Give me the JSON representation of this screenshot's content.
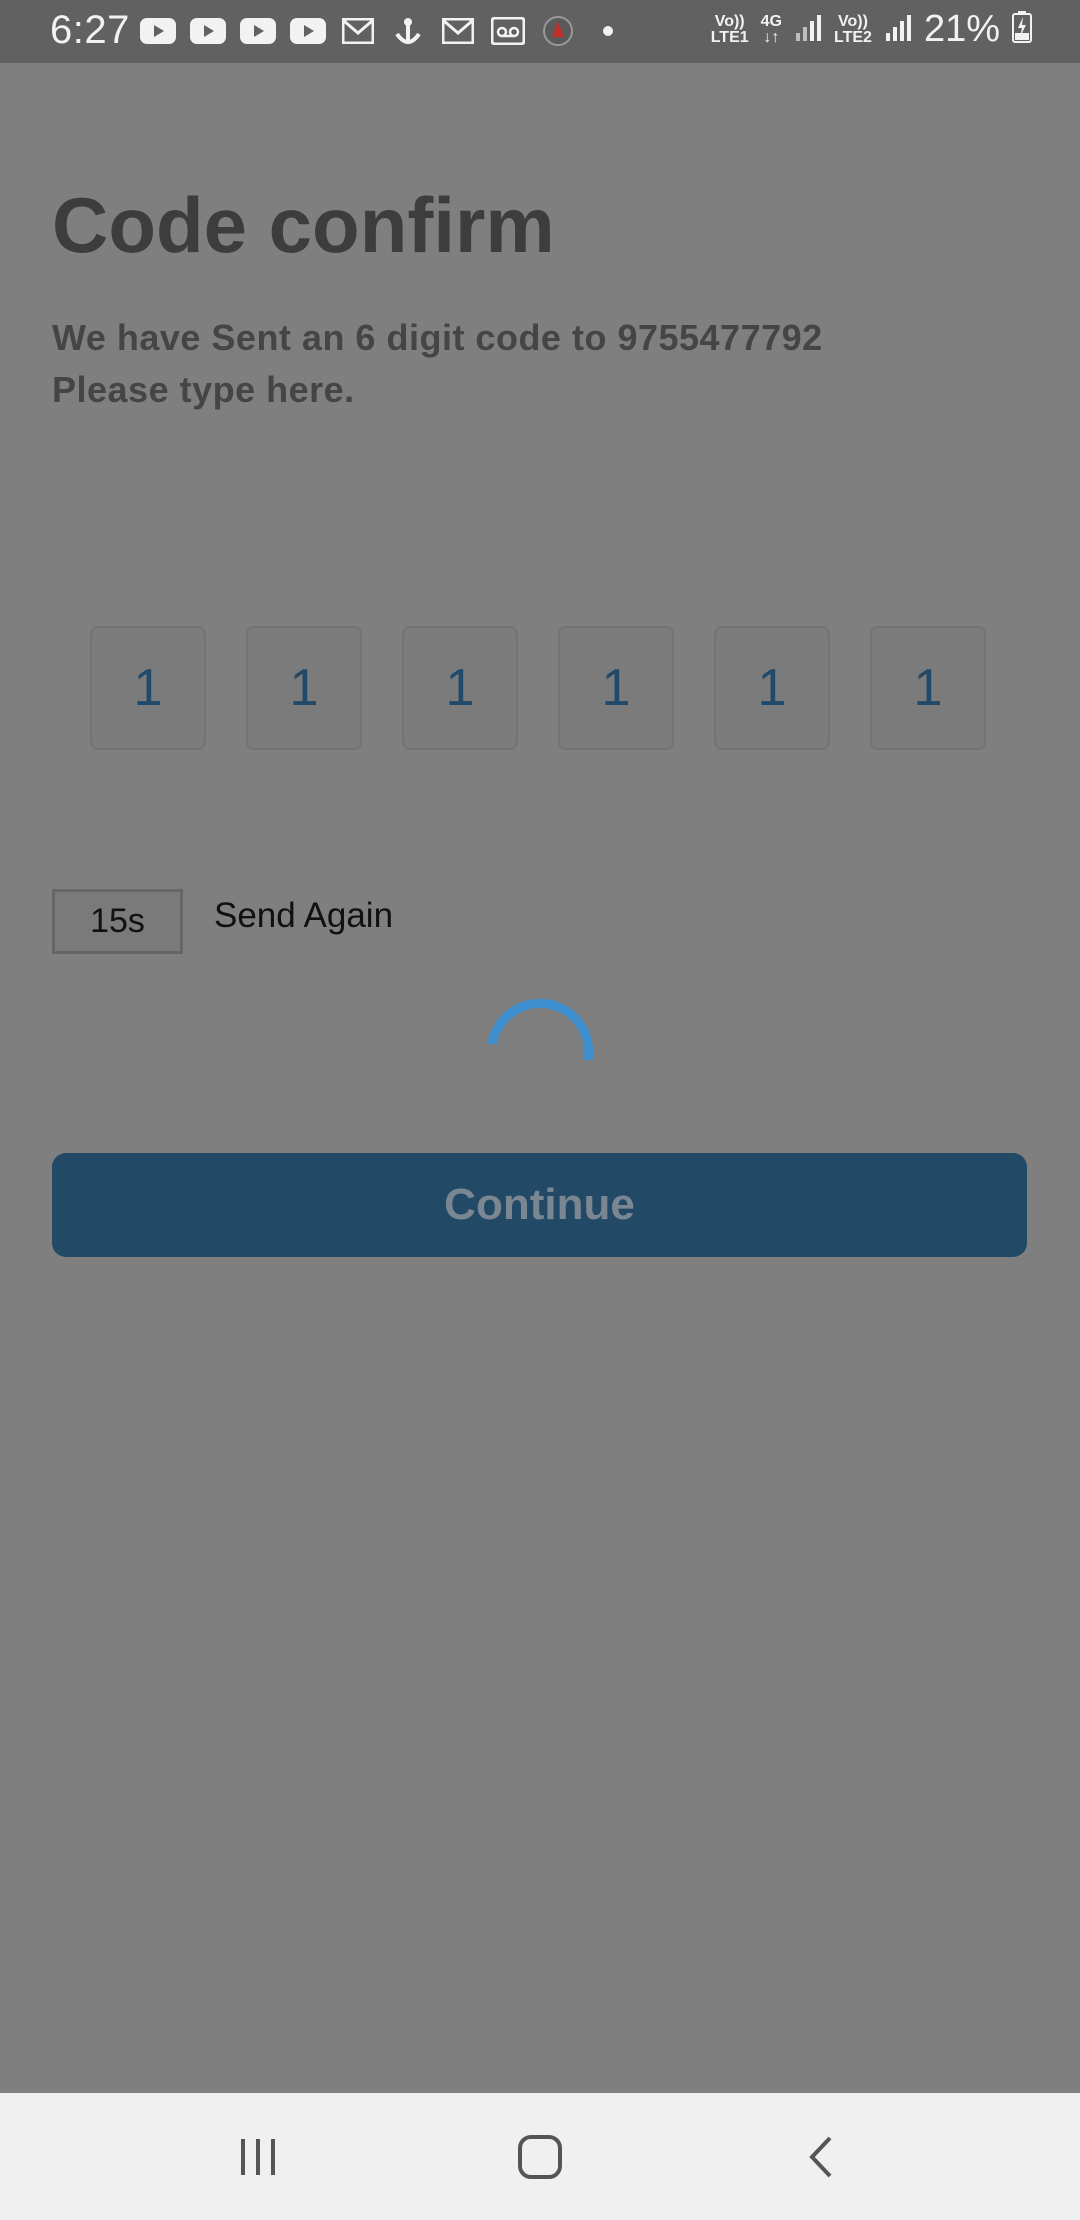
{
  "status_bar": {
    "time": "6:27",
    "notification_icons": [
      "youtube-icon",
      "youtube-icon",
      "youtube-icon",
      "youtube-icon",
      "gmail-icon",
      "anchor-icon",
      "gmail-icon",
      "voicemail-icon",
      "app-icon",
      "dot-icon"
    ],
    "lte1_line1": "Vo))",
    "lte1_line2": "LTE1",
    "net_line1": "4G",
    "net_line2": "↓↑",
    "lte2_line1": "Vo))",
    "lte2_line2": "LTE2",
    "battery": "21%"
  },
  "page": {
    "title": "Code confirm",
    "subtitle_line1": "We have Sent an 6 digit code to 9755477792",
    "subtitle_line2": "Please type here."
  },
  "code": {
    "digits": [
      "1",
      "1",
      "1",
      "1",
      "1",
      "1"
    ]
  },
  "resend": {
    "timer": "15s",
    "label": "Send Again"
  },
  "continue_label": "Continue",
  "colors": {
    "overlay": "#7f7f7f",
    "primary_button": "#224966",
    "spinner": "#3d8fd0",
    "digit": "#20496a"
  },
  "nav": {
    "recents": "recents-icon",
    "home": "home-icon",
    "back": "back-icon"
  }
}
